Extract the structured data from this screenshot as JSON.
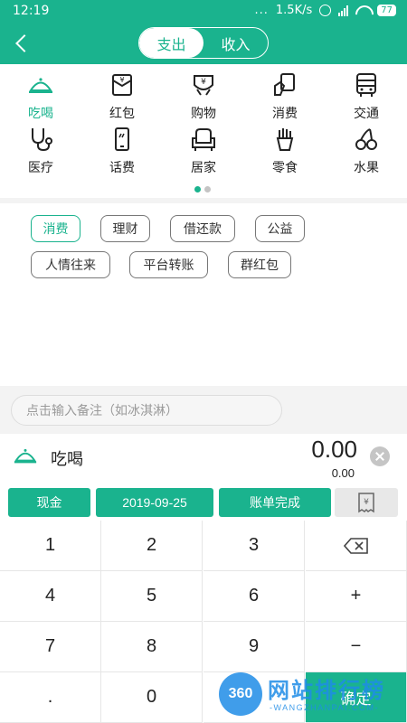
{
  "status_bar": {
    "time": "12:19",
    "dots": "...",
    "net_speed": "1.5K/s",
    "battery": "77"
  },
  "header": {
    "tabs": [
      {
        "label": "支出",
        "selected": true
      },
      {
        "label": "收入",
        "selected": false
      }
    ]
  },
  "accent_color": "#1ab38e",
  "categories": [
    {
      "label": "吃喝",
      "icon": "food-cover-icon",
      "selected": true
    },
    {
      "label": "红包",
      "icon": "red-packet-icon"
    },
    {
      "label": "购物",
      "icon": "shopping-bag-icon"
    },
    {
      "label": "消费",
      "icon": "card-swipe-icon"
    },
    {
      "label": "交通",
      "icon": "bus-icon"
    },
    {
      "label": "医疗",
      "icon": "stethoscope-icon"
    },
    {
      "label": "话费",
      "icon": "phone-icon"
    },
    {
      "label": "居家",
      "icon": "armchair-icon"
    },
    {
      "label": "零食",
      "icon": "fries-icon"
    },
    {
      "label": "水果",
      "icon": "cherries-icon"
    }
  ],
  "pager": {
    "pages": 2,
    "current": 1
  },
  "tags": [
    {
      "label": "消费",
      "selected": true
    },
    {
      "label": "理财"
    },
    {
      "label": "借还款"
    },
    {
      "label": "公益"
    },
    {
      "label": "人情往来"
    },
    {
      "label": "平台转账"
    },
    {
      "label": "群红包"
    }
  ],
  "note": {
    "placeholder": "点击输入备注（如冰淇淋）"
  },
  "amount": {
    "category_label": "吃喝",
    "value": "0.00",
    "sub_value": "0.00"
  },
  "options": {
    "account": "现金",
    "date": "2019-09-25",
    "done": "账单完成",
    "receipt_icon": "receipt-icon"
  },
  "keypad": {
    "keys": [
      "1",
      "2",
      "3",
      "⌫",
      "4",
      "5",
      "6",
      "+",
      "7",
      "8",
      "9",
      "−",
      ".",
      "0",
      "",
      "确定"
    ]
  },
  "watermark": {
    "badge": "360",
    "title": "网站排行榜",
    "subtitle": "-WANGZHANPAI.COM-"
  }
}
